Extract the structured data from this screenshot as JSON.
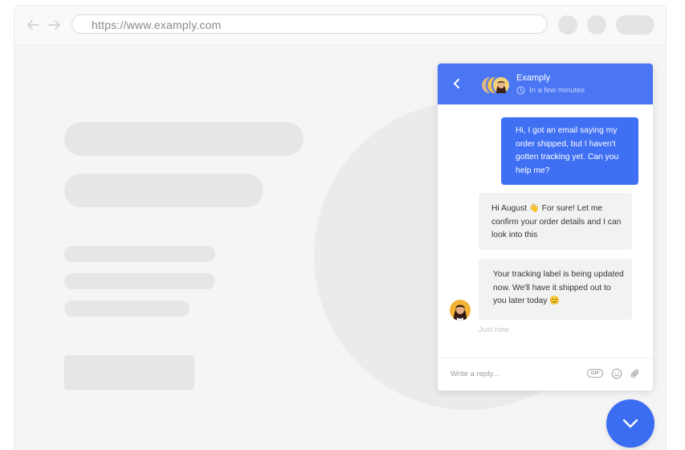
{
  "browser": {
    "url": "https://www.examply.com",
    "icons": {
      "back": "arrow-left-icon",
      "forward": "arrow-right-icon"
    }
  },
  "chat": {
    "header": {
      "title": "Examply",
      "subtitle": "In a few minutes",
      "icons": {
        "back": "chevron-left-icon",
        "clock": "clock-icon"
      }
    },
    "messages": [
      {
        "from": "user",
        "text": "Hi, I got an email saying my order shipped, but I haven't gotten tracking yet. Can you help me?"
      },
      {
        "from": "agent",
        "text": "Hi August 👋 For sure! Let me confirm your order details and I can look into this"
      },
      {
        "from": "agent",
        "text": "Your tracking label is being updated now. We'll have it shipped out to you later today 😊"
      }
    ],
    "timestamp": "Just now",
    "composer": {
      "placeholder": "Write a reply...",
      "gif_label": "GIF",
      "icons": {
        "emoji": "smiley-icon",
        "attach": "paperclip-icon"
      }
    }
  },
  "launcher": {
    "icon": "chevron-down-icon"
  },
  "colors": {
    "accent": "#4a76f4",
    "user_bubble": "#3f6ff3",
    "agent_bubble": "#f2f2f2",
    "page_bg": "#f5f5f5"
  }
}
